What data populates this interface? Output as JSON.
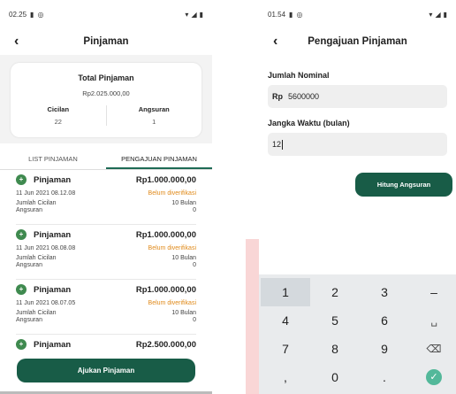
{
  "left": {
    "status": {
      "time": "02.25"
    },
    "header": {
      "title": "Pinjaman"
    },
    "summary": {
      "title": "Total Pinjaman",
      "amount": "Rp2.025.000,00",
      "cicilan_label": "Cicilan",
      "cicilan_value": "22",
      "angsuran_label": "Angsuran",
      "angsuran_value": "1"
    },
    "tabs": [
      {
        "label": "LIST PINJAMAN"
      },
      {
        "label": "PENGAJUAN PINJAMAN"
      }
    ],
    "items": [
      {
        "name": "Pinjaman",
        "amount": "Rp1.000.000,00",
        "date": "11 Jun 2021 08.12.08",
        "status": "Belum diverifikasi",
        "cicilan_label": "Jumlah Cicilan",
        "cicilan_value": "10 Bulan",
        "angsuran_label": "Angsuran",
        "angsuran_value": "0"
      },
      {
        "name": "Pinjaman",
        "amount": "Rp1.000.000,00",
        "date": "11 Jun 2021 08.08.08",
        "status": "Belum diverifikasi",
        "cicilan_label": "Jumlah Cicilan",
        "cicilan_value": "10 Bulan",
        "angsuran_label": "Angsuran",
        "angsuran_value": "0"
      },
      {
        "name": "Pinjaman",
        "amount": "Rp1.000.000,00",
        "date": "11 Jun 2021 08.07.05",
        "status": "Belum diverifikasi",
        "cicilan_label": "Jumlah Cicilan",
        "cicilan_value": "10 Bulan",
        "angsuran_label": "Angsuran",
        "angsuran_value": "0"
      },
      {
        "name": "Pinjaman",
        "amount": "Rp2.500.000,00"
      }
    ],
    "submit_label": "Ajukan Pinjaman"
  },
  "right": {
    "status": {
      "time": "01.54"
    },
    "header": {
      "title": "Pengajuan Pinjaman"
    },
    "nominal": {
      "label": "Jumlah Nominal",
      "prefix": "Rp",
      "value": "5600000"
    },
    "jangka": {
      "label": "Jangka Waktu (bulan)",
      "value": "12"
    },
    "hitung_label": "Hitung Angsuran",
    "keypad": {
      "k1": "1",
      "k2": "2",
      "k3": "3",
      "k_minus": "–",
      "k4": "4",
      "k5": "5",
      "k6": "6",
      "k_space": "␣",
      "k7": "7",
      "k8": "8",
      "k9": "9",
      "k_del": "⌫",
      "k_comma": ",",
      "k0": "0",
      "k_dot": ".",
      "k_ok": "✓"
    }
  },
  "colors": {
    "primary": "#185c47",
    "status_pending": "#e08a1a",
    "item_dot": "#3f8a4f",
    "ok_key": "#53b89a"
  }
}
